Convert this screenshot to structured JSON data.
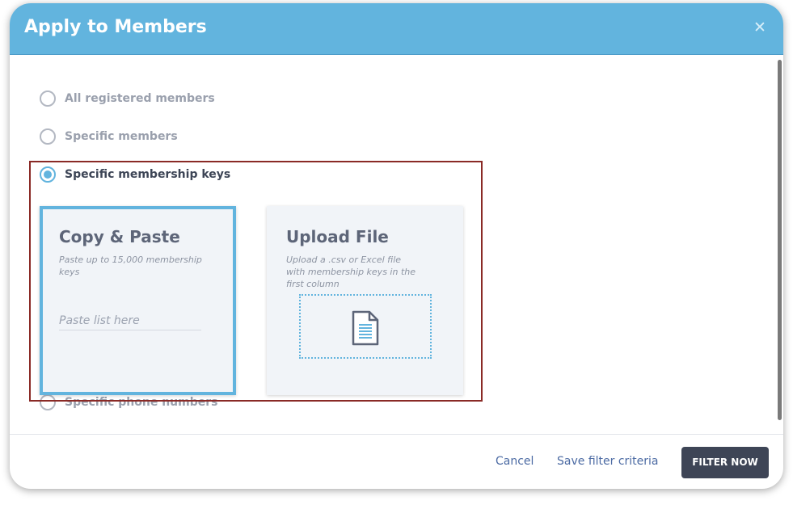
{
  "dialog": {
    "title": "Apply to Members",
    "close_glyph": "✕"
  },
  "options": [
    {
      "label": "All registered members",
      "checked": false
    },
    {
      "label": "Specific members",
      "checked": false
    },
    {
      "label": "Specific membership keys",
      "checked": true
    },
    {
      "label": "Specific phone numbers",
      "checked": false
    }
  ],
  "copy_paste": {
    "title": "Copy & Paste",
    "description": "Paste up to 15,000 membership keys",
    "placeholder": "Paste list here",
    "value": ""
  },
  "upload": {
    "title": "Upload File",
    "description": "Upload a .csv or Excel file with membership keys in the first column",
    "icon": "document-icon"
  },
  "footer": {
    "cancel_label": "Cancel",
    "save_label": "Save filter criteria",
    "filter_label": "FILTER NOW"
  },
  "colors": {
    "header": "#62b4de",
    "selected_border": "#62b4de",
    "highlight_frame": "#8a2a26",
    "primary_button": "#3e4556",
    "link": "#4b6aa3"
  }
}
